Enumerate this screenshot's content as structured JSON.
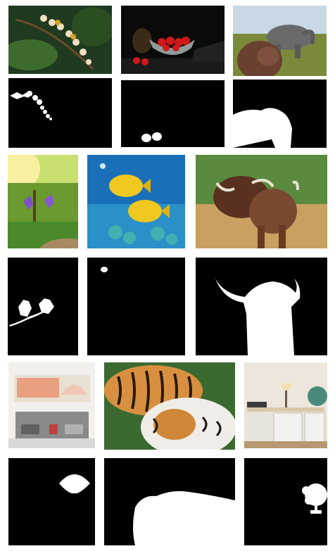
{
  "grid": {
    "title": "",
    "rows": [
      {
        "photos": [
          "flower-branch",
          "red-cherries-in-glass-bowl",
          "two-elephants"
        ],
        "masks": [
          "flower-branch-mask",
          "cherries-mask",
          "elephant-mask"
        ]
      },
      {
        "photos": [
          "purple-flowers-in-park",
          "two-yellow-fish",
          "highland-cattle"
        ],
        "masks": [
          "flowers-mask",
          "fish-mask",
          "cattle-mask"
        ]
      },
      {
        "photos": [
          "bedroom-with-fan-painting",
          "tigers",
          "desk-with-fan"
        ],
        "masks": [
          "fan-painting-mask",
          "tiger-mask",
          "desk-fan-mask"
        ]
      }
    ]
  }
}
